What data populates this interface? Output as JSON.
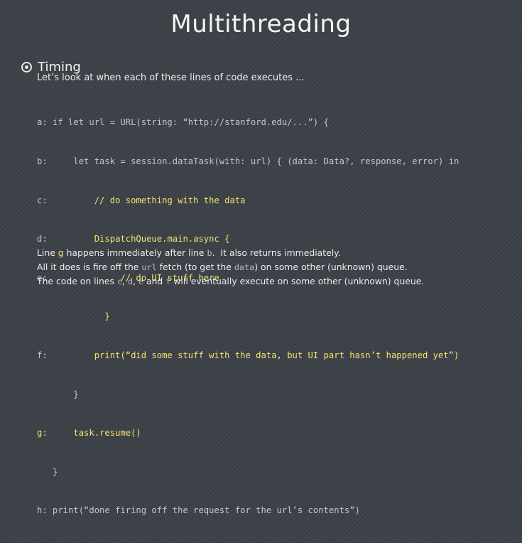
{
  "slide": {
    "title": "Multithreading",
    "bullet": "Timing",
    "intro": "Let’s look at when each of these lines of code executes ...",
    "code": {
      "a": "a: if let url = URL(string: “http://stanford.edu/...”) {",
      "b": "b:     let task = session.dataTask(with: url) { (data: Data?, response, error) in",
      "c_label": "c:",
      "c_text": "         // do something with the data",
      "d_label": "d:",
      "d_text": "         DispatchQueue.main.async {",
      "e_label": "e:",
      "e_text": "              // do UI stuff here",
      "brace_inner": "             }",
      "f_label": "f:",
      "f_text": "         print(“did some stuff with the data, but UI part hasn’t happened yet”)",
      "brace_task": "       }",
      "g_label": "g:",
      "g_text": "     task.resume()",
      "brace_if": "   }",
      "h": "h: print(“done firing off the request for the url’s contents”)"
    },
    "prose": {
      "p1_a": "Line ",
      "p1_g": "g",
      "p1_b": " happens immediately after line ",
      "p1_bcode": "b",
      "p1_c": ".  It also returns immediately.",
      "p2_a": "All it does is fire off the ",
      "p2_url": "url",
      "p2_b": " fetch (to get the ",
      "p2_data": "data",
      "p2_c": ") on some other (unknown) queue.",
      "p3_a": "The code on lines ",
      "p3_c": "c",
      "p3_sep1": ", ",
      "p3_d": "d",
      "p3_sep2": ", ",
      "p3_e": "e",
      "p3_and": " and ",
      "p3_f": "f",
      "p3_b": " will eventually execute on some other (unknown) queue."
    }
  }
}
